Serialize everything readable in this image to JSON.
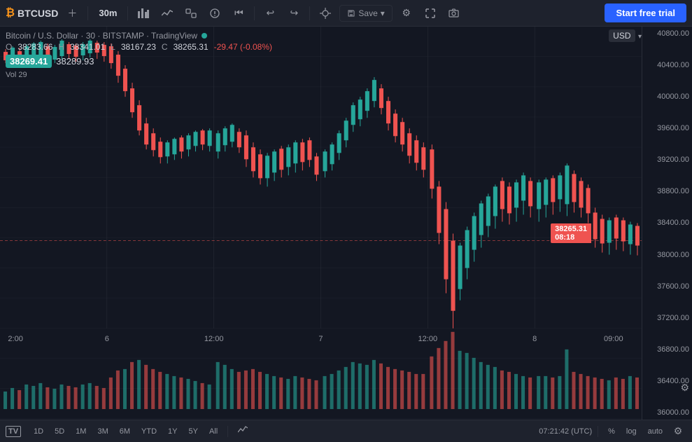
{
  "header": {
    "symbol": "BTCUSD",
    "timeframe": "30m",
    "start_trial_label": "Start free trial",
    "save_label": "Save"
  },
  "chart": {
    "title": "Bitcoin / U.S. Dollar · 30 · BITSTAMP · TradingView",
    "open_label": "O",
    "high_label": "H",
    "low_label": "L",
    "close_label": "C",
    "open_val": "38283.66",
    "high_val": "38341.01",
    "low_val": "38167.23",
    "close_val": "38265.31",
    "change_val": "-29.47 (-0.08%)",
    "current_price": "38265.31",
    "current_time": "08:18",
    "price1": "38269.41",
    "price2": "38289.93",
    "vol_label": "Vol",
    "vol_val": "29",
    "currency": "USD",
    "price_levels": [
      "40800.00",
      "40400.00",
      "40000.00",
      "39600.00",
      "39200.00",
      "38800.00",
      "38400.00",
      "38000.00",
      "37600.00",
      "37200.00",
      "36800.00",
      "36400.00",
      "36000.00"
    ]
  },
  "bottom_bar": {
    "periods": [
      "1D",
      "5D",
      "1M",
      "3M",
      "6M",
      "YTD",
      "1Y",
      "5Y",
      "All"
    ],
    "active_period": "",
    "time": "07:21:42 (UTC)",
    "pct_label": "%",
    "log_label": "log",
    "auto_label": "auto"
  }
}
